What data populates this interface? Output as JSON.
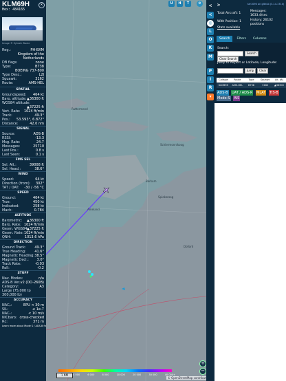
{
  "info": {
    "callsign": "KLM69H",
    "hex_label": "Hex:",
    "hex": "484165",
    "close_glyph": "×",
    "photo_credit": "Image © Sylvain Boule",
    "general": [
      {
        "label": "Reg.:",
        "value": "PH-BXM"
      },
      {
        "label": "",
        "value": "Kingdom of the"
      },
      {
        "label": "",
        "value": "Netherlands"
      },
      {
        "label": "DB flags:",
        "value": "none"
      },
      {
        "label": "Type:",
        "value": "B738"
      },
      {
        "label": "",
        "value": "BOEING 737-800"
      },
      {
        "label": "Type Desc.:",
        "value": "L2J"
      },
      {
        "label": "Squawk:",
        "value": "3162"
      },
      {
        "label": "Route:",
        "value": "AMS-HEL"
      }
    ],
    "sections": [
      {
        "title": "SPATIAL",
        "rows": [
          {
            "label": "Groundspeed:",
            "value": "464 kt"
          },
          {
            "label": "Baro. altitude:",
            "value": "▲36300 ft"
          },
          {
            "label": "WGS84 altitude:",
            "value": ""
          },
          {
            "label": "",
            "value": "▲37225 ft"
          },
          {
            "label": "Vert. Rate:",
            "value": "1024 ft/min"
          },
          {
            "label": "Track:",
            "value": "49.3°"
          },
          {
            "label": "Pos.:",
            "value": "53.593°, 6.872°"
          },
          {
            "label": "Distance:",
            "value": "42.0 nm"
          }
        ]
      },
      {
        "title": "SIGNAL",
        "rows": [
          {
            "label": "Source:",
            "value": "ADS-B"
          },
          {
            "label": "RSSI:",
            "value": "-13.3"
          },
          {
            "label": "Msg. Rate:",
            "value": "24.7"
          },
          {
            "label": "Messages:",
            "value": "25710"
          },
          {
            "label": "Last Pos.:",
            "value": "0.8 s"
          },
          {
            "label": "Last Seen:",
            "value": "0.1 s"
          }
        ]
      },
      {
        "title": "FMS SEL",
        "rows": [
          {
            "label": "Sel. Alt.:",
            "value": "39008 ft"
          },
          {
            "label": "Sel. Head.:",
            "value": "38.6°"
          }
        ]
      },
      {
        "title": "WIND",
        "rows": [
          {
            "label": "Speed:",
            "value": "64 kt"
          },
          {
            "label": "Direction (from):",
            "value": "302°"
          },
          {
            "label": "TAT / OAT:",
            "value": "-30 / -56 °C"
          }
        ]
      },
      {
        "title": "SPEED",
        "rows": [
          {
            "label": "Ground:",
            "value": "464 kt"
          },
          {
            "label": "True:",
            "value": "450 kt"
          },
          {
            "label": "Indicated:",
            "value": "258 kt"
          },
          {
            "label": "Mach:",
            "value": "0.784"
          }
        ]
      },
      {
        "title": "ALTITUDE",
        "rows": [
          {
            "label": "Barometric:",
            "value": "▲36300 ft"
          },
          {
            "label": "Baro. Rate:",
            "value": "1024 ft/min"
          },
          {
            "label": "Geom. WGS84:",
            "value": "▲37225 ft"
          },
          {
            "label": "Geom. Rate:",
            "value": "1024 ft/min"
          },
          {
            "label": "QNH:",
            "value": "1013.6 hPa"
          }
        ]
      },
      {
        "title": "DIRECTION",
        "rows": [
          {
            "label": "Ground Track:",
            "value": "49.3°"
          },
          {
            "label": "True Heading:",
            "value": "41.6°"
          },
          {
            "label": "Magnetic Heading:",
            "value": "38.5°"
          },
          {
            "label": "Magnetic Decl.:",
            "value": "3.0°"
          },
          {
            "label": "Track Rate:",
            "value": "-0.03"
          },
          {
            "label": "Roll:",
            "value": "-0.2"
          }
        ]
      },
      {
        "title": "STUFF",
        "rows": [
          {
            "label": "Nav. Modes:",
            "value": "n/a"
          },
          {
            "label": "ADS-B Ver.:",
            "value": "v2 (DO-260B)"
          },
          {
            "label": "Category:",
            "value": "A3"
          },
          {
            "label": "Large (75,000 to",
            "value": ""
          },
          {
            "label": "300,000 lb)",
            "value": ""
          }
        ]
      },
      {
        "title": "ACCURACY",
        "rows": [
          {
            "label": "NACₚ:",
            "value": "EPU < 30 m"
          },
          {
            "label": "SIL:",
            "value": "≤ 1e-7"
          },
          {
            "label": "NACᵥ:",
            "value": "< 10 m/s"
          },
          {
            "label": "NICbaro:",
            "value": "cross-checked"
          },
          {
            "label": "Rc:",
            "value": "371 m"
          }
        ]
      }
    ],
    "footer": "Learn more about Mode S / ADS-B from the Mode S docs"
  },
  "map": {
    "top_buttons": [
      "U",
      "H",
      "T"
    ],
    "places": [
      "Ruttermond",
      "Ameland",
      "Spiekeroog",
      "Schiermonnikoog",
      "Borkum",
      "Dollard"
    ],
    "scale_label": "1 NM",
    "attribution": "© OpenStreetMap contributors",
    "altitude_ticks": [
      "2 000",
      "4 000",
      "6 000",
      "8 000",
      "10 000",
      "20 000",
      "30 000",
      "40 000+"
    ],
    "zoom_in": "+",
    "zoom_out": "−"
  },
  "toolbar": {
    "nav_arrows": [
      "<",
      ">"
    ],
    "buttons": [
      "L",
      "O",
      "K",
      "M",
      "P",
      "I",
      "R"
    ]
  },
  "right": {
    "github": "tar1090 on github (3.14.1710)",
    "stats": {
      "total_aircraft": "Total Aircraft: 1",
      "with_position": "With Position: 1",
      "stats_available": "Stats available",
      "messages_label": "Messages:",
      "messages_rate": "1633.4/sec",
      "history_label": "History: 26102",
      "history_positions": "positions"
    },
    "tabs": [
      "Search",
      "Filters",
      "Columns"
    ],
    "search_label": "Search:",
    "search_button": "Search",
    "clear_search": "Clear Search",
    "jump_label": "Jump to Airport or Latitude, Longitude:",
    "jump_button": "Jump",
    "clear_button": "Clear",
    "table_headers": [
      "Callsign",
      "Route",
      "Type",
      "Squawk",
      "Alt. (ft)"
    ],
    "table_row": [
      "KLM69H",
      "AMS-HEL",
      "B738",
      "3162",
      "▲36300"
    ],
    "sources": [
      "ADS-B",
      "UAT / ADS-R",
      "MLAT",
      "TIS-B",
      "Mode-S",
      "AIS"
    ]
  },
  "colors": {
    "panel_bg": "#0d2a3f",
    "button_blue": "#1d7fb1",
    "sea": "#7f9fa6",
    "land": "#8b97a0",
    "track": "#6a3cff"
  }
}
